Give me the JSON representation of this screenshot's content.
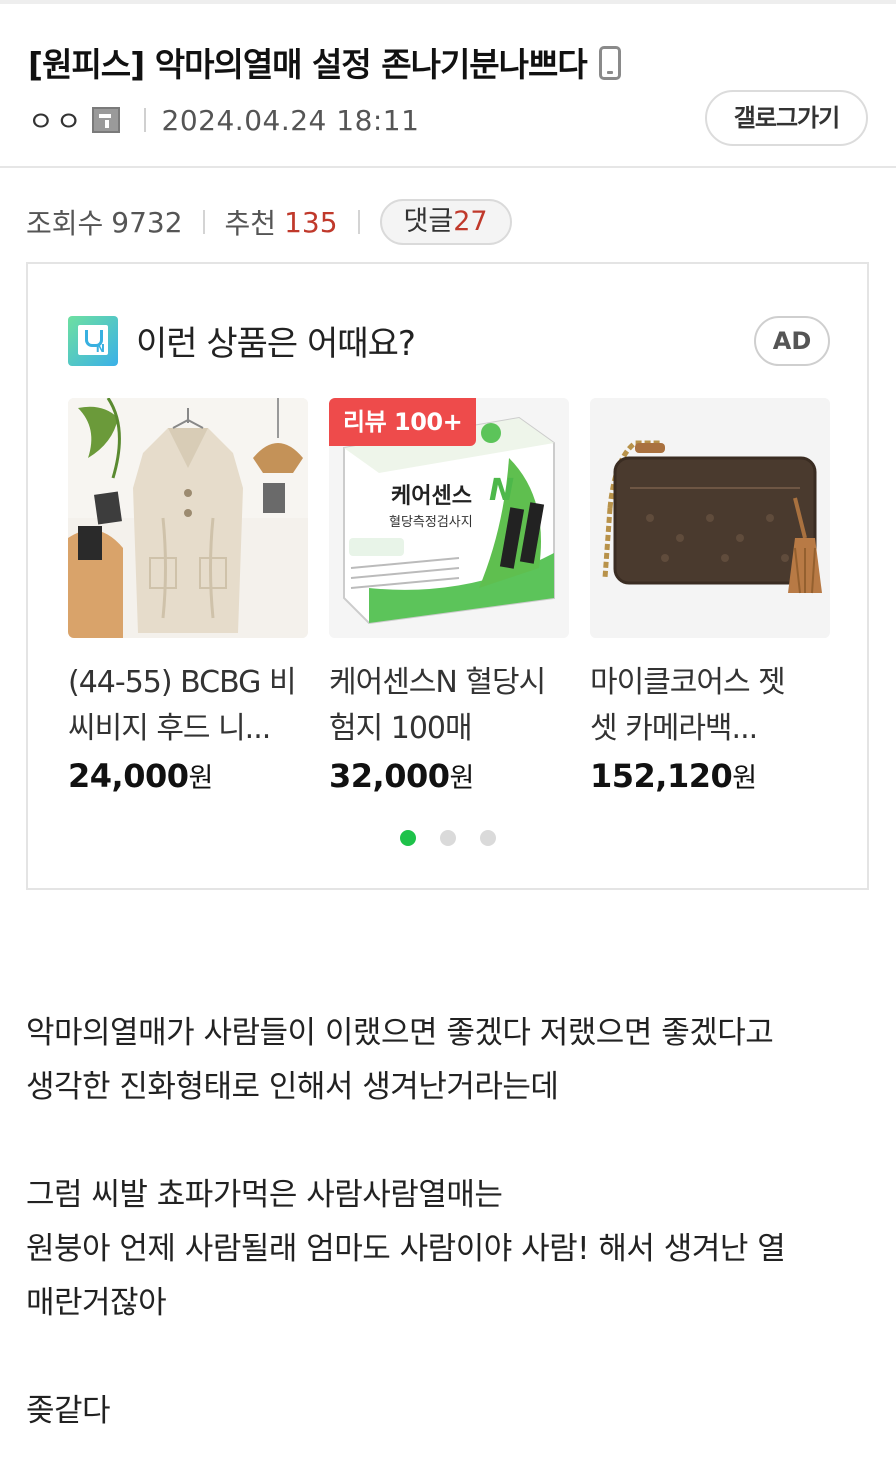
{
  "post": {
    "title": "[원피스] 악마의열매 설정 존나기분나쁘다",
    "author": "ㅇㅇ",
    "date": "2024.04.24 18:11",
    "gallery_button": "갤로그가기"
  },
  "stats": {
    "views_label": "조회수",
    "views": "9732",
    "recommend_label": "추천",
    "recommend": "135",
    "comments_label": "댓글",
    "comments": "27"
  },
  "ad": {
    "heading": "이런 상품은 어때요?",
    "badge": "AD",
    "products": [
      {
        "name_line1": "(44-55) BCBG 비",
        "name_line2": "씨비지 후드 니...",
        "price": "24,000",
        "currency": "원"
      },
      {
        "badge": "리뷰 100+",
        "name_line1": "케어센스N 혈당시",
        "name_line2": "험지 100매",
        "price": "32,000",
        "currency": "원",
        "box_brand": "케어센스",
        "box_sub": "혈당측정검사지"
      },
      {
        "name_line1": "마이클코어스 젯",
        "name_line2": "셋 카메라백...",
        "price": "152,120",
        "currency": "원"
      }
    ],
    "carousel": {
      "pages": 3,
      "active_page": 1,
      "active_color": "#1ec24a"
    }
  },
  "body": {
    "paragraphs": [
      [
        "악마의열매가 사람들이 이랬으면 좋겠다 저랬으면 좋겠다고",
        "생각한 진화형태로 인해서 생겨난거라는데"
      ],
      [
        "그럼 씨발 쵸파가먹은 사람사람열매는",
        "원붕아 언제 사람될래 엄마도 사람이야 사람! 해서 생겨난 열",
        "매란거잖아"
      ],
      [
        "좆같다"
      ]
    ]
  },
  "colors": {
    "accent_red": "#c0392b",
    "review_badge": "#ee4b4b"
  }
}
